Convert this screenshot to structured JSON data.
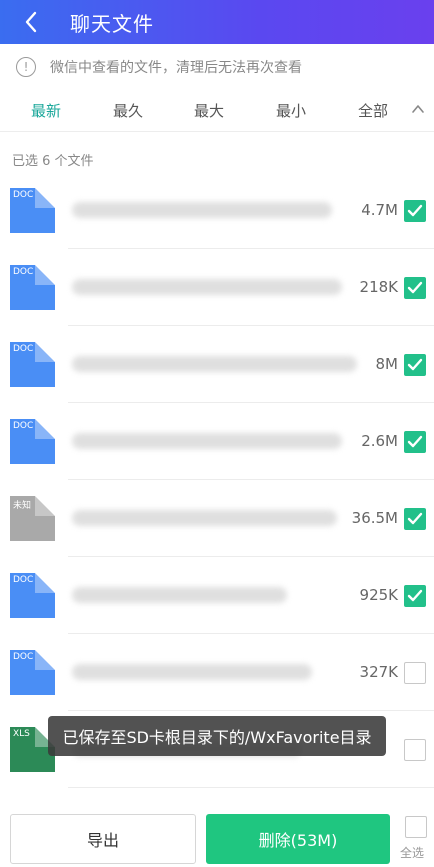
{
  "header": {
    "title": "聊天文件"
  },
  "notice": {
    "icon": "info-icon",
    "text": "微信中查看的文件，清理后无法再次查看"
  },
  "tabs": [
    {
      "label": "最新",
      "active": true
    },
    {
      "label": "最久",
      "active": false
    },
    {
      "label": "最大",
      "active": false
    },
    {
      "label": "最小",
      "active": false
    },
    {
      "label": "全部",
      "active": false
    }
  ],
  "selection": {
    "text": "已选 6 个文件"
  },
  "files": [
    {
      "type": "DOC",
      "color": "#4a8ef5",
      "size": "4.7M",
      "checked": true
    },
    {
      "type": "DOC",
      "color": "#4a8ef5",
      "size": "218K",
      "checked": true
    },
    {
      "type": "DOC",
      "color": "#4a8ef5",
      "size": "8M",
      "checked": true
    },
    {
      "type": "DOC",
      "color": "#4a8ef5",
      "size": "2.6M",
      "checked": true
    },
    {
      "type": "未知",
      "color": "#a9a9a9",
      "size": "36.5M",
      "checked": true
    },
    {
      "type": "DOC",
      "color": "#4a8ef5",
      "size": "925K",
      "checked": true
    },
    {
      "type": "DOC",
      "color": "#4a8ef5",
      "size": "327K",
      "checked": false
    },
    {
      "type": "XLS",
      "color": "#2c8a57",
      "size": "",
      "checked": false
    }
  ],
  "toast": {
    "text": "已保存至SD卡根目录下的/WxFavorite目录"
  },
  "footer": {
    "export_label": "导出",
    "delete_label": "删除(53M)",
    "select_all_label": "全选"
  },
  "colors": {
    "accent": "#1aa79a",
    "check": "#22c08a",
    "delete_button": "#1fc680",
    "header_start": "#3a6df0",
    "header_end": "#6a40ee"
  }
}
